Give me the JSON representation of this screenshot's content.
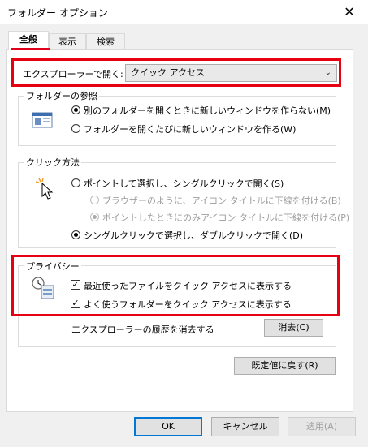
{
  "window": {
    "title": "フォルダー オプション",
    "close_glyph": "✕"
  },
  "tabs": [
    {
      "label": "全般",
      "active": true
    },
    {
      "label": "表示",
      "active": false
    },
    {
      "label": "検索",
      "active": false
    }
  ],
  "open_with": {
    "label": "エクスプローラーで開く:",
    "value": "クイック アクセス"
  },
  "browse": {
    "legend": "フォルダーの参照",
    "options": [
      {
        "label": "別のフォルダーを開くときに新しいウィンドウを作らない(M)",
        "selected": true
      },
      {
        "label": "フォルダーを開くたびに新しいウィンドウを作る(W)",
        "selected": false
      }
    ]
  },
  "click": {
    "legend": "クリック方法",
    "options": [
      {
        "label": "ポイントして選択し、シングルクリックで開く(S)",
        "selected": false
      },
      {
        "label": "ブラウザーのように、アイコン タイトルに下線を付ける(B)",
        "selected": false,
        "disabled": true
      },
      {
        "label": "ポイントしたときにのみアイコン タイトルに下線を付ける(P)",
        "selected": true,
        "disabled": true
      },
      {
        "label": "シングルクリックで選択し、ダブルクリックで開く(D)",
        "selected": true
      }
    ]
  },
  "privacy": {
    "legend": "プライバシー",
    "checks": [
      {
        "label": "最近使ったファイルをクイック アクセスに表示する",
        "checked": true
      },
      {
        "label": "よく使うフォルダーをクイック アクセスに表示する",
        "checked": true
      }
    ],
    "clear_label": "エクスプローラーの履歴を消去する",
    "clear_button": "消去(C)"
  },
  "restore_button": "既定値に戻す(R)",
  "footer": {
    "ok": "OK",
    "cancel": "キャンセル",
    "apply": "適用(A)"
  },
  "colors": {
    "highlight": "#e60012",
    "accent": "#0078d7"
  }
}
